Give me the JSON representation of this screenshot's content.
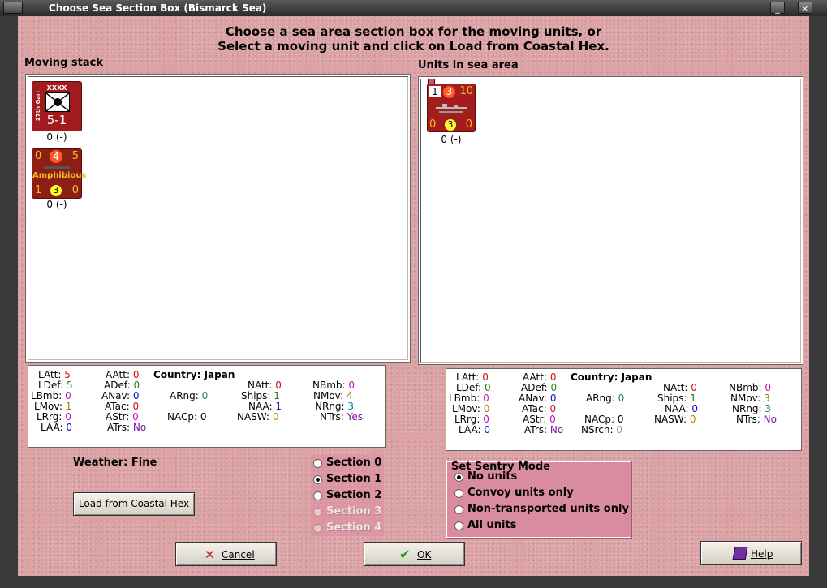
{
  "window": {
    "title": "Choose Sea Section Box (Bismarck Sea)"
  },
  "instructions": {
    "line1": "Choose a sea area section box for the moving units, or",
    "line2": "Select a moving unit and click on Load from Coastal Hex."
  },
  "moving_stack": {
    "label": "Moving stack",
    "units": [
      {
        "type": "garrison",
        "top_text": "XXXX",
        "side_text": "27th Garr",
        "strength": "5-1",
        "label": "0 (-)"
      },
      {
        "type": "amphibious",
        "top_left": "0",
        "top_mid": "4",
        "top_right": "5",
        "name": "Amphibious",
        "bot_left": "1",
        "bot_mid": "3",
        "bot_right": "0",
        "label": "0 (-)"
      }
    ]
  },
  "sea_area": {
    "label": "Units in sea area",
    "units": [
      {
        "type": "ship",
        "top_left": "1",
        "top_mid": "3",
        "top_right": "10",
        "bot_left": "0",
        "bot_mid": "3",
        "bot_right": "0",
        "label": "0 (-)"
      }
    ]
  },
  "stats_left": {
    "country_label": "Country: Japan",
    "LAtt": "5",
    "LDef": "5",
    "LBmb": "0",
    "LMov": "1",
    "LRrg": "0",
    "LAA": "0",
    "AAtt": "0",
    "ADef": "0",
    "ANav": "0",
    "ATac": "0",
    "AStr": "0",
    "ATrs": "No",
    "ARng": "0",
    "NACp": "0",
    "NAtt": "0",
    "Ships": "1",
    "NAA": "1",
    "NASW": "0",
    "NBmb": "0",
    "NMov": "4",
    "NRng": "3",
    "NTrs": "Yes"
  },
  "stats_right": {
    "country_label": "Country: Japan",
    "LAtt": "0",
    "LDef": "0",
    "LBmb": "0",
    "LMov": "0",
    "LRrg": "0",
    "LAA": "0",
    "AAtt": "0",
    "ADef": "0",
    "ANav": "0",
    "ATac": "0",
    "AStr": "0",
    "ATrs": "No",
    "ARng": "0",
    "NACp": "0",
    "NSrch": "0",
    "NAtt": "0",
    "Ships": "1",
    "NAA": "0",
    "NASW": "0",
    "NBmb": "0",
    "NMov": "3",
    "NRng": "3",
    "NTrs": "No"
  },
  "weather": {
    "label": "Weather: Fine"
  },
  "load_button": "Load from Coastal Hex",
  "sections": [
    {
      "label": "Section 0",
      "checked": false,
      "enabled": true
    },
    {
      "label": "Section 1",
      "checked": true,
      "enabled": true
    },
    {
      "label": "Section 2",
      "checked": false,
      "enabled": true
    },
    {
      "label": "Section 3",
      "checked": false,
      "enabled": false
    },
    {
      "label": "Section 4",
      "checked": false,
      "enabled": false
    }
  ],
  "sentry": {
    "title": "Set Sentry Mode",
    "options": [
      "No units",
      "Convoy units only",
      "Non-transported units only",
      "All units"
    ],
    "selected_index": 0
  },
  "buttons": {
    "cancel": "Cancel",
    "ok": "OK",
    "help": "Help"
  },
  "colors": {
    "background": "#dba2a5",
    "counter_red": "#a01a1e",
    "stat_red": "#d01010",
    "stat_green": "#208020",
    "stat_magenta": "#c010c0",
    "stat_olive": "#908000",
    "stat_teal": "#108080",
    "stat_blue": "#1010c0",
    "stat_orange": "#d08000",
    "stat_purple": "#8010a0"
  }
}
